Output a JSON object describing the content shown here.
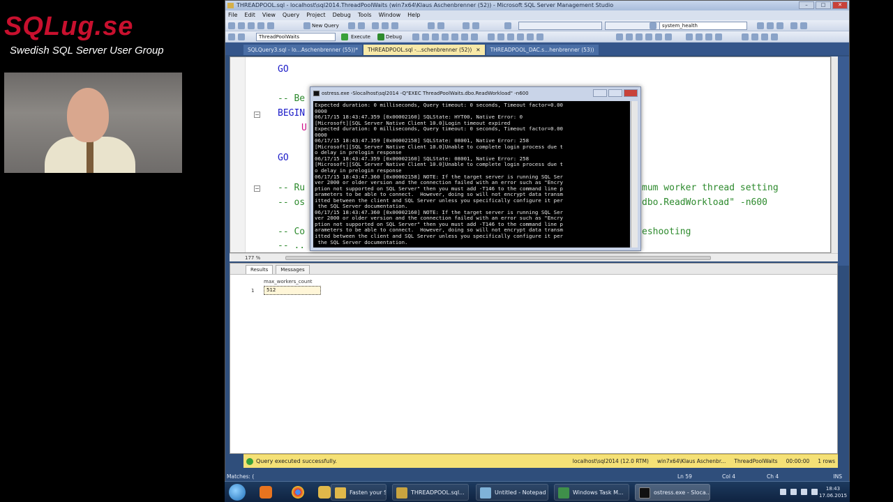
{
  "branding": {
    "logo_text": "SQLug.se",
    "tagline": "Swedish SQL Server User Group"
  },
  "ssms": {
    "window_title": "THREADPOOL.sql - localhost\\sql2014.ThreadPoolWaits (win7x64\\Klaus Aschenbrenner (52)) - Microsoft SQL Server Management Studio",
    "menu": [
      "File",
      "Edit",
      "View",
      "Query",
      "Project",
      "Debug",
      "Tools",
      "Window",
      "Help"
    ],
    "toolbar": {
      "new_query": "New Query",
      "database": "ThreadPoolWaits",
      "execute": "Execute",
      "debug": "Debug",
      "session_combo": "system_health"
    },
    "tabs": [
      {
        "label": "SQLQuery3.sql - lo...Aschenbrenner (55))*",
        "active": false
      },
      {
        "label": "THREADPOOL.sql -...schenbrenner (52))",
        "active": true,
        "close": "✕"
      },
      {
        "label": "THREADPOOL_DAC.s...henbrenner (53))",
        "active": false
      }
    ],
    "editor": {
      "lines": [
        {
          "text": "GO",
          "cls": "kw"
        },
        {
          "text": "-- Be",
          "cls": "cm"
        },
        {
          "text": "BEGIN",
          "cls": "kw"
        },
        {
          "text": "U",
          "cls": "pk"
        },
        {
          "text": "GO",
          "cls": "kw"
        },
        {
          "text": "-- Ru",
          "cls": "cm"
        },
        {
          "text": "-- os",
          "cls": "cm"
        },
        {
          "text": "-- Co",
          "cls": "cm"
        },
        {
          "text": "-- ..",
          "cls": "cm"
        }
      ],
      "right_fragments": [
        {
          "text": "mum worker thread setting",
          "cls": "cm"
        },
        {
          "text": "dbo.ReadWorkload\" -n600",
          "cls": "cm"
        },
        {
          "text": "eshooting",
          "cls": "cm"
        }
      ],
      "zoom": "177 %"
    },
    "results": {
      "tab_results": "Results",
      "tab_messages": "Messages",
      "column": "max_workers_count",
      "row_number": "1",
      "value": "512"
    },
    "status": {
      "message": "Query executed successfully.",
      "server": "localhost\\sql2014 (12.0 RTM)",
      "user": "win7x64\\Klaus Aschenbr...",
      "database": "ThreadPoolWaits",
      "elapsed": "00:00:00",
      "rows": "1 rows"
    },
    "bottom": {
      "matches": "Matches: (",
      "ln": "Ln 59",
      "col": "Col 4",
      "ch": "Ch 4",
      "ins": "INS"
    }
  },
  "console": {
    "title": "ostress.exe -Slocalhost\\sql2014 -Q\"EXEC ThreadPoolWaits.dbo.ReadWorkload\" -n600",
    "lines": [
      "Expected duration: 0 milliseconds, Query timeout: 0 seconds, Timeout factor=0.00",
      "0000",
      "06/17/15 18:43:47.359 [0x00002160] SQLState: HYT00, Native Error: 0",
      "[Microsoft][SQL Server Native Client 10.0]Login timeout expired",
      "Expected duration: 0 milliseconds, Query timeout: 0 seconds, Timeout factor=0.00",
      "0000",
      "06/17/15 18:43:47.359 [0x00002158] SQLState: 08001, Native Error: 258",
      "[Microsoft][SQL Server Native Client 10.0]Unable to complete login process due t",
      "o delay in prelogin response",
      "06/17/15 18:43:47.359 [0x00002160] SQLState: 08001, Native Error: 258",
      "[Microsoft][SQL Server Native Client 10.0]Unable to complete login process due t",
      "o delay in prelogin response",
      "06/17/15 18:43:47.360 [0x00002158] NOTE: If the target server is running SQL Ser",
      "ver 2000 or older version and the connection failed with an error such as \"Encry",
      "ption not supported on SQL Server\" then you must add -T146 to the command line p",
      "arameters to be able to connect.  However, doing so will not encrypt data transm",
      "itted between the client and SQL Server unless you specifically configure it per",
      " the SQL Server documentation.",
      "06/17/15 18:43:47.360 [0x00002160] NOTE: If the target server is running SQL Ser",
      "ver 2000 or older version and the connection failed with an error such as \"Encry",
      "ption not supported on SQL Server\" then you must add -T146 to the command line p",
      "arameters to be able to connect.  However, doing so will not encrypt data transm",
      "itted between the client and SQL Server unless you specifically configure it per",
      " the SQL Server documentation."
    ]
  },
  "taskbar": {
    "tasks": [
      {
        "label": "Fasten your Seatb...",
        "color": "#e0b84a"
      },
      {
        "label": "THREADPOOL.sql...",
        "color": "#c9a440"
      },
      {
        "label": "Untitled - Notepad",
        "color": "#7fb2d8"
      },
      {
        "label": "Windows Task M...",
        "color": "#3f8f4a"
      },
      {
        "label": "ostress.exe - Sloca...",
        "color": "#111111"
      }
    ],
    "clock_time": "18:43",
    "clock_date": "17.06.2015"
  }
}
